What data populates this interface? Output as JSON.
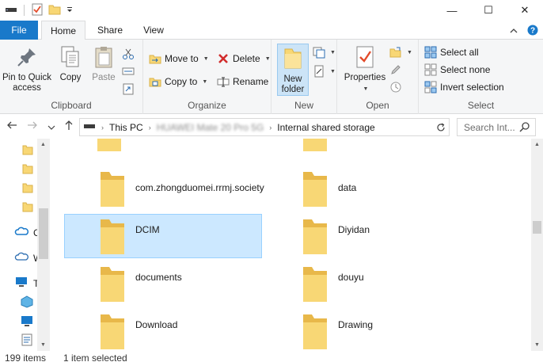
{
  "titlebar": {
    "qat_icons": [
      "drive-icon",
      "properties-check-icon",
      "folder-icon",
      "dropdown-icon"
    ],
    "controls": {
      "minimize": "—",
      "maximize": "☐",
      "close": "✕"
    }
  },
  "tabs": [
    {
      "label": "File"
    },
    {
      "label": "Home"
    },
    {
      "label": "Share"
    },
    {
      "label": "View"
    }
  ],
  "ribbon": {
    "clipboard": {
      "label": "Clipboard",
      "pin": "Pin to Quick\naccess",
      "copy": "Copy",
      "paste": "Paste"
    },
    "organize": {
      "label": "Organize",
      "move_to": "Move to",
      "copy_to": "Copy to",
      "delete": "Delete",
      "rename": "Rename"
    },
    "new": {
      "label": "New",
      "new_folder": "New\nfolder"
    },
    "open": {
      "label": "Open",
      "properties": "Properties"
    },
    "select": {
      "label": "Select",
      "select_all": "Select all",
      "select_none": "Select none",
      "invert_selection": "Invert selection"
    }
  },
  "address": {
    "segments": [
      "This PC",
      "HUAWEI Mate 20 Pro 5G",
      "Internal shared storage"
    ],
    "search_placeholder": "Search Int..."
  },
  "navpane": {
    "items": [
      {
        "label": "",
        "icon": "folder-icon"
      },
      {
        "label": "",
        "icon": "folder-icon"
      },
      {
        "label": "",
        "icon": "folder-icon"
      },
      {
        "label": "",
        "icon": "folder-icon"
      },
      {
        "label": "C",
        "icon": "onedrive-icon"
      },
      {
        "label": "W",
        "icon": "network-icon"
      },
      {
        "label": "T",
        "icon": "this-pc-icon"
      },
      {
        "label": "",
        "icon": "3d-objects-icon"
      },
      {
        "label": "",
        "icon": "desktop-icon"
      },
      {
        "label": "",
        "icon": "documents-icon"
      }
    ]
  },
  "folders": [
    {
      "name": "",
      "col": 0
    },
    {
      "name": "",
      "col": 1
    },
    {
      "name": "com.zhongduomei.rrmj.society",
      "col": 0
    },
    {
      "name": "data",
      "col": 1
    },
    {
      "name": "DCIM",
      "col": 0,
      "selected": true
    },
    {
      "name": "Diyidan",
      "col": 1
    },
    {
      "name": "documents",
      "col": 0
    },
    {
      "name": "douyu",
      "col": 1
    },
    {
      "name": "Download",
      "col": 0
    },
    {
      "name": "Drawing",
      "col": 1
    }
  ],
  "status": {
    "count": "199 items",
    "selected": "1 item selected"
  },
  "colors": {
    "accent": "#1979ca",
    "selection_bg": "#cce8ff",
    "folder_yellow": "#f8d775"
  }
}
